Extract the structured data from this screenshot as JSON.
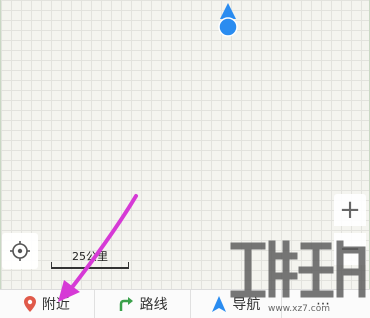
{
  "map": {
    "scale_label": "25公里"
  },
  "controls": {
    "zoom_in": "+",
    "zoom_out": "−"
  },
  "bottom_bar": {
    "tabs": [
      {
        "label": "附近",
        "icon": "map-pin-icon"
      },
      {
        "label": "路线",
        "icon": "route-arrow-icon"
      },
      {
        "label": "导航",
        "icon": "navigation-arrow-icon"
      },
      {
        "label": "",
        "icon": "more-icon"
      }
    ]
  },
  "watermark": {
    "url": "www.xz7.com"
  },
  "colors": {
    "accent_blue": "#2a8cf0",
    "annotation_magenta": "#d63ad6",
    "nearby_pin": "#e05a4a",
    "route_green": "#3aa04a"
  }
}
